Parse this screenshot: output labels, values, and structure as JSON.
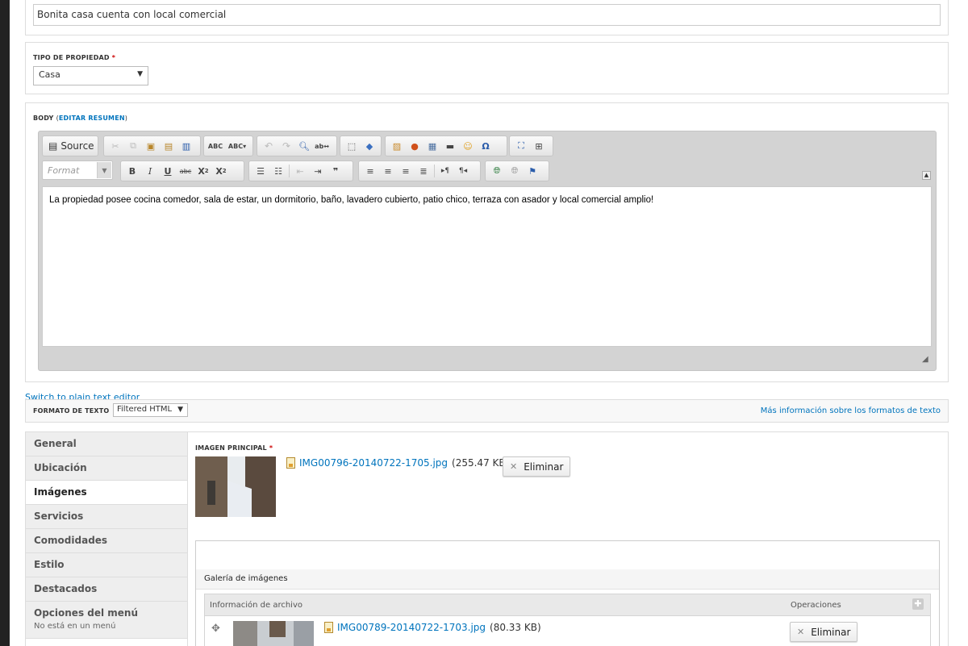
{
  "title_field": {
    "value": "Bonita casa cuenta con  local comercial"
  },
  "property_type": {
    "label": "TIPO DE PROPIEDAD",
    "required_mark": "*",
    "value": "Casa"
  },
  "body": {
    "label": "BODY",
    "edit_summary_link": "EDITAR RESUMEN",
    "toolbar": {
      "source_label": "Source",
      "format_placeholder": "Format"
    },
    "content": "La propiedad posee cocina comedor, sala de estar, un dormitorio, baño, lavadero cubierto, patio chico, terraza con asador y local comercial amplio!"
  },
  "switch_editor_link": "Switch to plain text editor",
  "text_format": {
    "label": "FORMATO DE TEXTO",
    "value": "Filtered HTML",
    "more_info_link": "Más información sobre los formatos de texto"
  },
  "vertical_tabs": [
    {
      "label": "General"
    },
    {
      "label": "Ubicación"
    },
    {
      "label": "Imágenes"
    },
    {
      "label": "Servicios"
    },
    {
      "label": "Comodidades"
    },
    {
      "label": "Estilo"
    },
    {
      "label": "Destacados"
    },
    {
      "label": "Opciones del menú",
      "summary": "No está en un menú"
    }
  ],
  "main_image": {
    "label": "IMAGEN PRINCIPAL",
    "required_mark": "*",
    "filename": "IMG00796-20140722-1705.jpg",
    "size": "(255.47 KB)",
    "remove_label": "Eliminar"
  },
  "gallery": {
    "title": "Galería de imágenes",
    "columns": {
      "file_info": "Información de archivo",
      "operations": "Operaciones"
    },
    "rows": [
      {
        "filename": "IMG00789-20140722-1703.jpg",
        "size": "(80.33 KB)",
        "remove_label": "Eliminar"
      }
    ]
  },
  "colors": {
    "link": "#0074bd",
    "required": "#cc0000"
  }
}
